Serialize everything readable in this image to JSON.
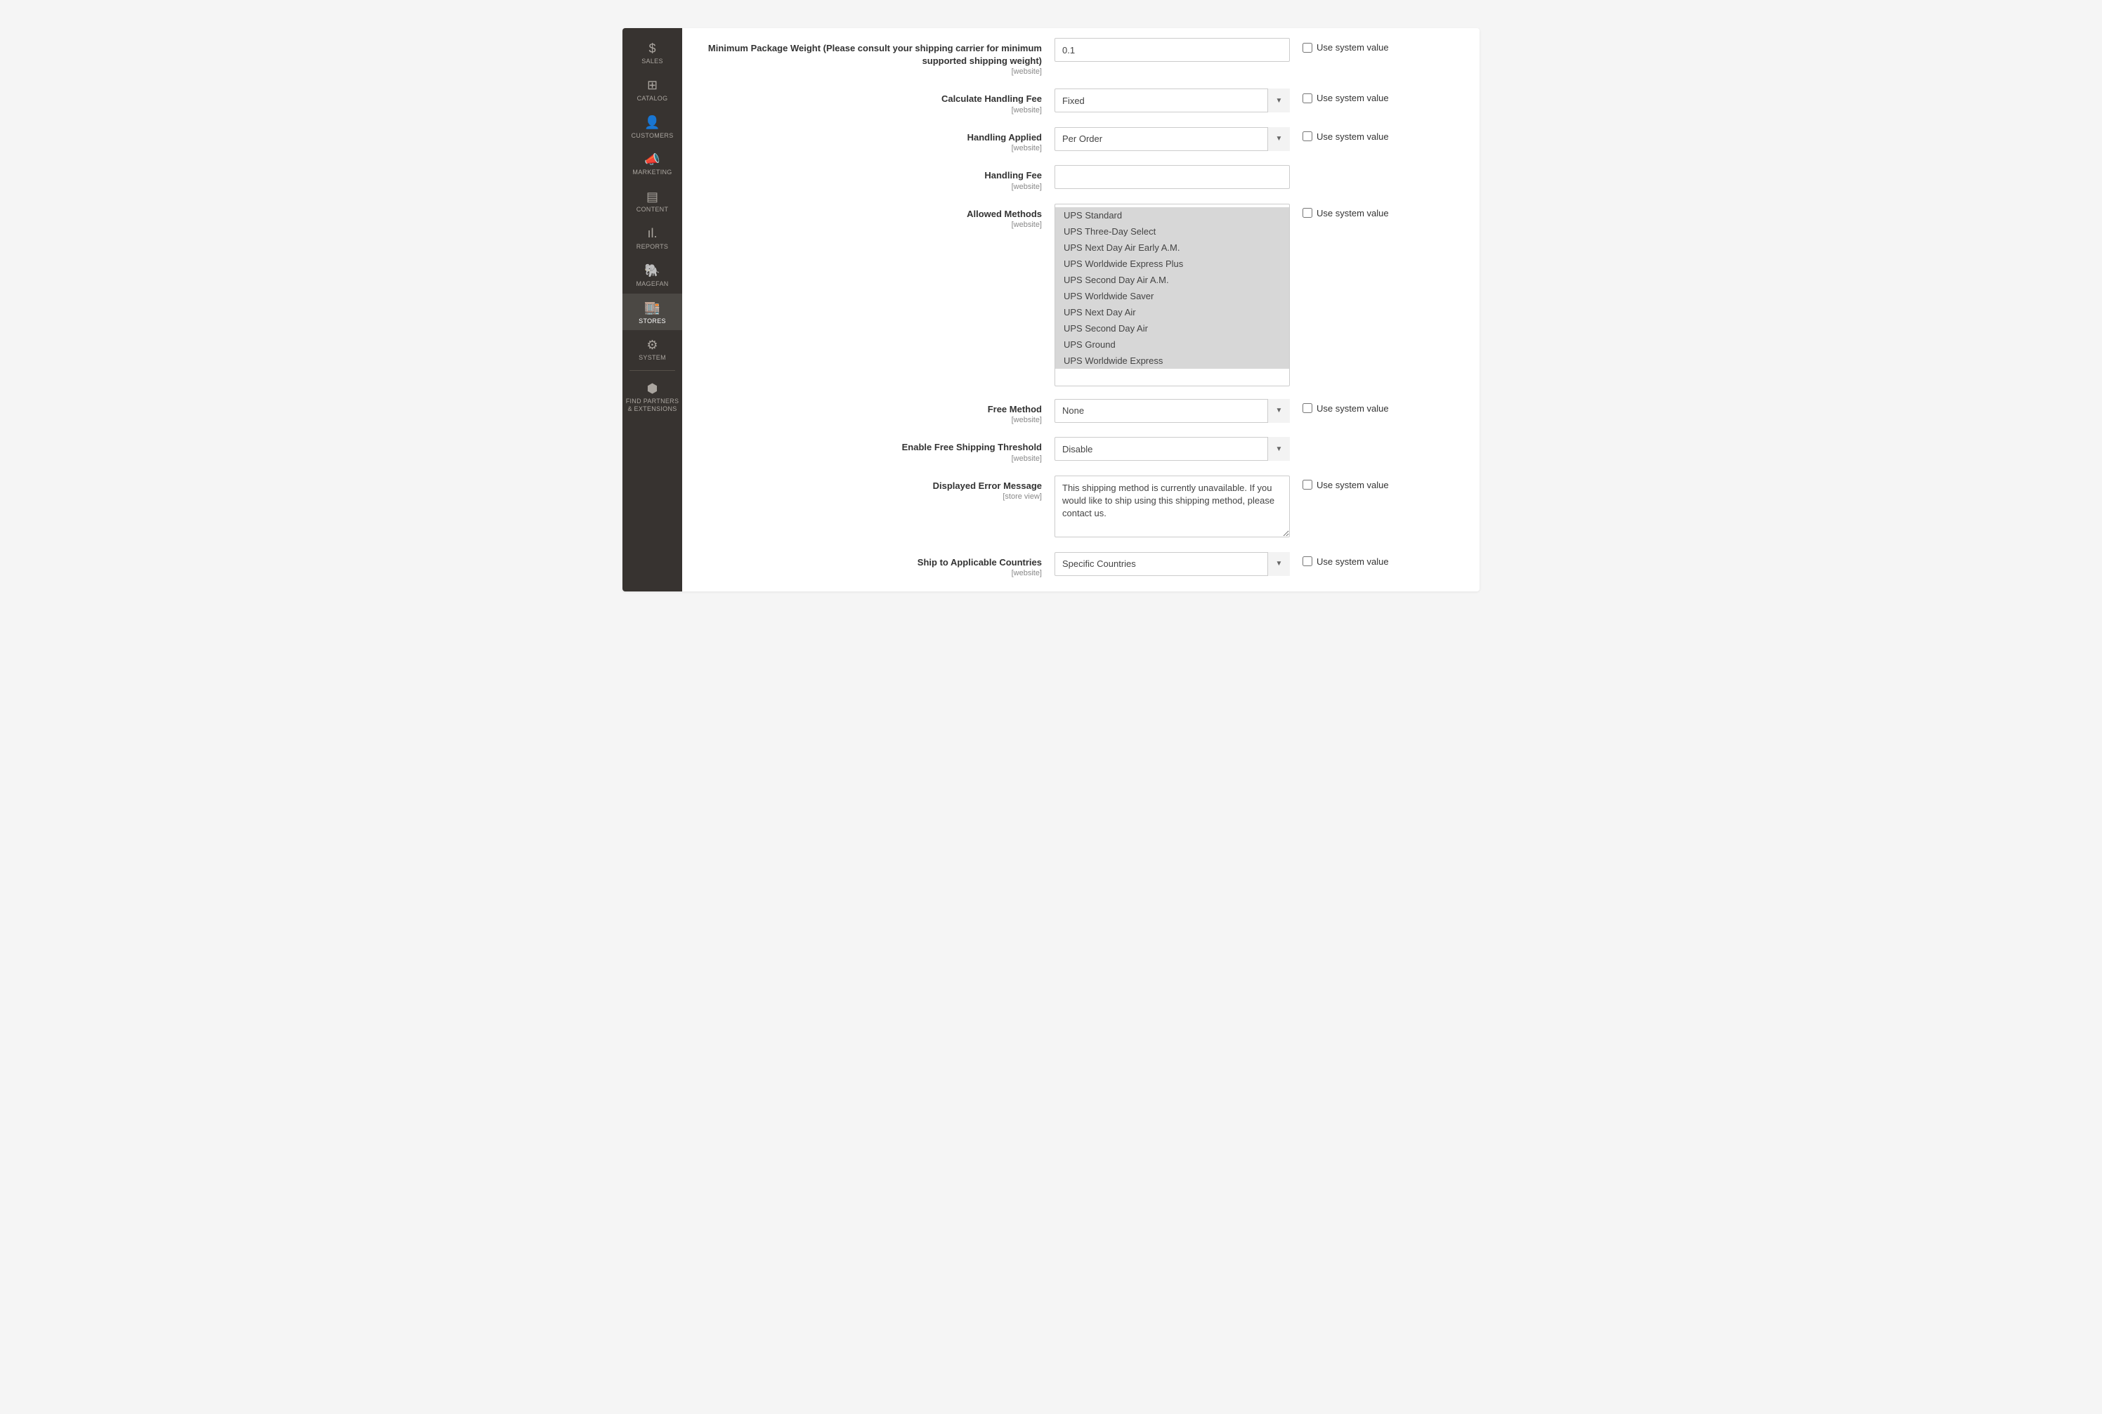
{
  "sidebar": {
    "items": [
      {
        "label": "SALES",
        "icon": "$"
      },
      {
        "label": "CATALOG",
        "icon": "⊞"
      },
      {
        "label": "CUSTOMERS",
        "icon": "👤"
      },
      {
        "label": "MARKETING",
        "icon": "📣"
      },
      {
        "label": "CONTENT",
        "icon": "▤"
      },
      {
        "label": "REPORTS",
        "icon": "ıl."
      },
      {
        "label": "MAGEFAN",
        "icon": "🐘"
      },
      {
        "label": "STORES",
        "icon": "🏬",
        "active": true
      },
      {
        "label": "SYSTEM",
        "icon": "⚙"
      },
      {
        "label": "FIND PARTNERS & EXTENSIONS",
        "icon": "⬢",
        "divider_before": true
      }
    ]
  },
  "common": {
    "use_system_value": "Use system value",
    "scope_website": "[website]",
    "scope_store_view": "[store view]"
  },
  "fields": {
    "min_package_weight": {
      "label": "Minimum Package Weight (Please consult your shipping carrier for minimum supported shipping weight)",
      "value": "0.1"
    },
    "calculate_handling_fee": {
      "label": "Calculate Handling Fee",
      "value": "Fixed"
    },
    "handling_applied": {
      "label": "Handling Applied",
      "value": "Per Order"
    },
    "handling_fee": {
      "label": "Handling Fee",
      "value": ""
    },
    "allowed_methods": {
      "label": "Allowed Methods",
      "options": [
        "UPS Standard",
        "UPS Three-Day Select",
        "UPS Next Day Air Early A.M.",
        "UPS Worldwide Express Plus",
        "UPS Second Day Air A.M.",
        "UPS Worldwide Saver",
        "UPS Next Day Air",
        "UPS Second Day Air",
        "UPS Ground",
        "UPS Worldwide Express"
      ]
    },
    "free_method": {
      "label": "Free Method",
      "value": "None"
    },
    "free_shipping_threshold": {
      "label": "Enable Free Shipping Threshold",
      "value": "Disable"
    },
    "error_message": {
      "label": "Displayed Error Message",
      "value": "This shipping method is currently unavailable. If you would like to ship using this shipping method, please contact us."
    },
    "ship_to_countries": {
      "label": "Ship to Applicable Countries",
      "value": "Specific Countries"
    }
  }
}
